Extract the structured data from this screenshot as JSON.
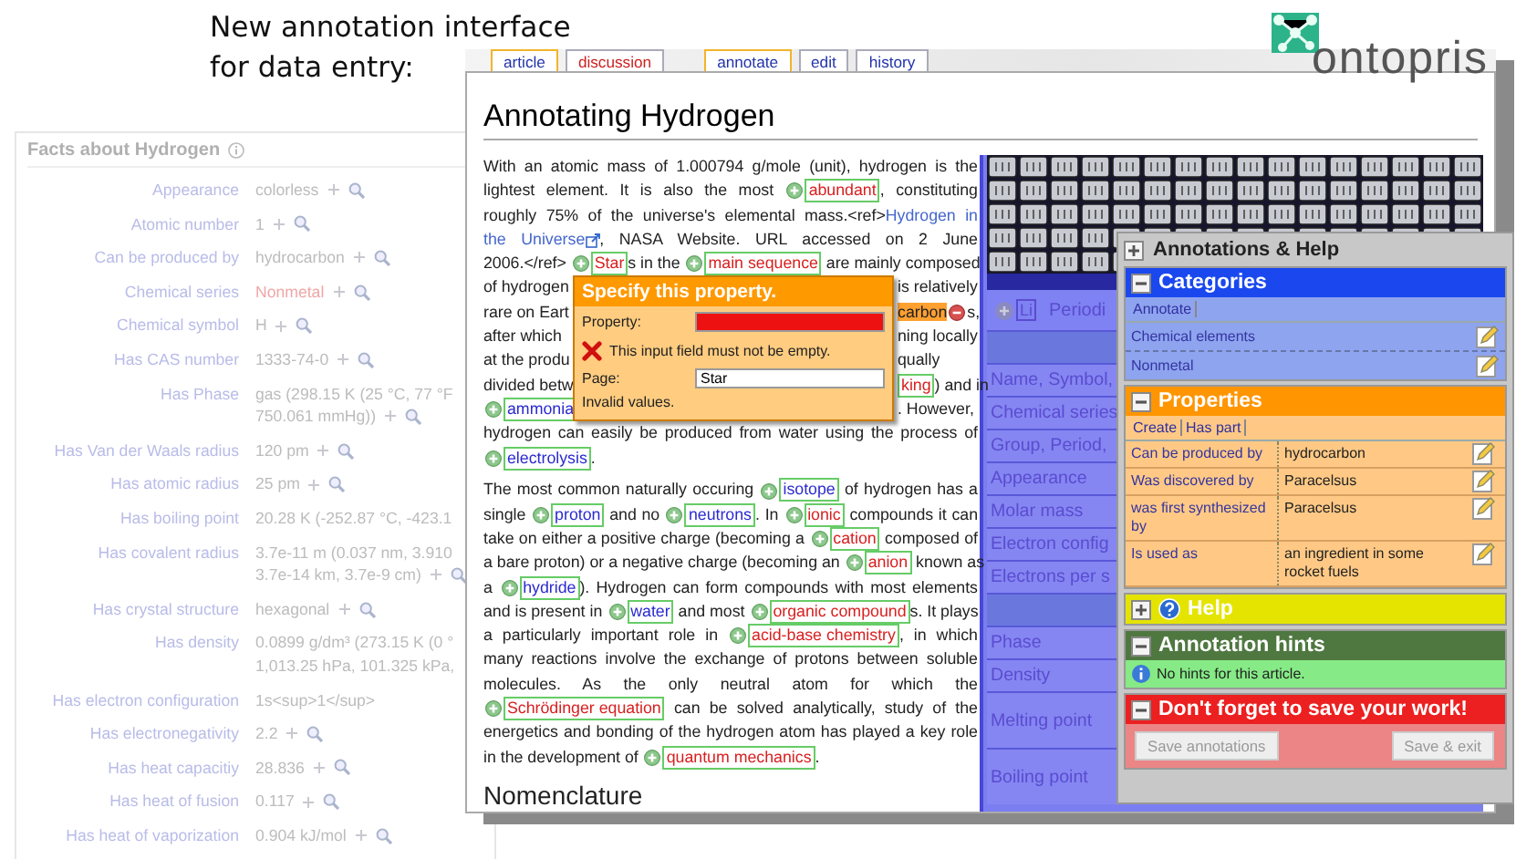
{
  "caption": [
    "New annotation interface",
    "for data entry:"
  ],
  "logo": {
    "text": "ontopris"
  },
  "facts_panel": {
    "title": "Facts about Hydrogen",
    "rows": [
      {
        "label": "Appearance",
        "lines": [
          "colorless"
        ],
        "tools": true,
        "exists": true
      },
      {
        "label": "Atomic number",
        "lines": [
          "1"
        ],
        "tools": true,
        "exists": true
      },
      {
        "label": "Can be produced by",
        "lines": [
          "hydrocarbon"
        ],
        "tools": true,
        "exists": true
      },
      {
        "label": "Chemical series",
        "lines": [
          "Nonmetal"
        ],
        "tools": true,
        "exists": false
      },
      {
        "label": "Chemical symbol",
        "lines": [
          "H"
        ],
        "tools": true,
        "exists": true
      },
      {
        "label": "Has CAS number",
        "lines": [
          "1333-74-0"
        ],
        "tools": true,
        "exists": true
      },
      {
        "label": "Has Phase",
        "lines": [
          "gas (298.15 K (25 °C, 77 °F",
          "750.061 mmHg))"
        ],
        "tools": true,
        "exists": true
      },
      {
        "label": "Has Van der Waals radius",
        "lines": [
          "120 pm"
        ],
        "tools": true,
        "exists": true
      },
      {
        "label": "Has atomic radius",
        "lines": [
          "25 pm"
        ],
        "tools": true,
        "exists": true
      },
      {
        "label": "Has boiling point",
        "lines": [
          "20.28 K (-252.87 °C, -423.1"
        ],
        "tools": false,
        "exists": true
      },
      {
        "label": "Has covalent radius",
        "lines": [
          "3.7e-11 m (0.037 nm, 3.910",
          "3.7e-14 km, 3.7e-9 cm)"
        ],
        "tools": true,
        "exists": true
      },
      {
        "label": "Has crystal structure",
        "lines": [
          "hexagonal"
        ],
        "tools": true,
        "exists": true
      },
      {
        "label": "Has density",
        "lines": [
          "0.0899 g/dm³ (273.15 K (0 °",
          "1,013.25 hPa, 101.325 kPa,"
        ],
        "tools": false,
        "exists": true
      },
      {
        "label": "Has electron configuration",
        "lines": [
          "1s<sup>1</sup>"
        ],
        "tools": false,
        "exists": true
      },
      {
        "label": "Has electronegativity",
        "lines": [
          "2.2"
        ],
        "tools": true,
        "exists": true
      },
      {
        "label": "Has heat capacitiy",
        "lines": [
          "28.836"
        ],
        "tools": true,
        "exists": true
      },
      {
        "label": "Has heat of fusion",
        "lines": [
          "0.117"
        ],
        "tools": true,
        "exists": true
      },
      {
        "label": "Has heat of vaporization",
        "lines": [
          "0.904 kJ/mol"
        ],
        "tools": true,
        "exists": true
      }
    ]
  },
  "window": {
    "page_tabs": [
      {
        "label": "article",
        "selected": true,
        "exists": true
      },
      {
        "label": "discussion",
        "selected": false,
        "exists": false
      }
    ],
    "action_tabs": [
      {
        "label": "annotate",
        "selected": true
      },
      {
        "label": "edit",
        "selected": false
      },
      {
        "label": "history",
        "selected": false
      }
    ],
    "title": "Annotating Hydrogen",
    "paragraphs": [
      {
        "lines": [
          {
            "segments": [
              {
                "kind": "text",
                "text": "With an atomic mass of 1.000794 g/mole (unit), hydrogen is the"
              }
            ]
          },
          {
            "segments": [
              {
                "kind": "text",
                "text": "lightest element. It is also the most "
              },
              {
                "kind": "annotation",
                "text": "abundant",
                "exists": false,
                "icon": true
              },
              {
                "kind": "text",
                "text": ", constituting"
              }
            ]
          },
          {
            "segments": [
              {
                "kind": "text",
                "text": "roughly 75% of the universe's elemental mass.<ref>"
              },
              {
                "kind": "external",
                "text": "Hydrogen in",
                "icon": false
              }
            ]
          },
          {
            "segments": [
              {
                "kind": "external",
                "text": "the Universe",
                "icon": true
              },
              {
                "kind": "text",
                "text": ", NASA Website. URL accessed on 2 June"
              }
            ]
          },
          {
            "segments": [
              {
                "kind": "text",
                "text": "2006.</ref> "
              },
              {
                "kind": "annotation",
                "text": "Star",
                "exists": false,
                "icon": true
              },
              {
                "kind": "text",
                "text": "s in the "
              },
              {
                "kind": "annotation",
                "text": "main sequence",
                "exists": false,
                "icon": true
              },
              {
                "kind": "text",
                "text": " are mainly composed"
              }
            ]
          },
          {
            "left": [
              {
                "kind": "text",
                "text": "of hydrogen"
              }
            ],
            "right": [
              {
                "kind": "text",
                "text": "is relatively"
              }
            ]
          },
          {
            "left": [
              {
                "kind": "text",
                "text": "rare on Eart"
              }
            ],
            "right": [
              {
                "kind": "editing",
                "text": "carbon"
              },
              {
                "kind": "text",
                "text": "s,"
              }
            ]
          },
          {
            "left": [
              {
                "kind": "text",
                "text": "after which"
              }
            ],
            "right": [
              {
                "kind": "text",
                "text": "ning locally"
              }
            ]
          },
          {
            "left": [
              {
                "kind": "text",
                "text": "at the produ"
              }
            ],
            "right": [
              {
                "kind": "text",
                "text": "qually"
              }
            ]
          },
          {
            "left": [
              {
                "kind": "text",
                "text": "divided betw"
              }
            ],
            "right": [
              {
                "kind": "annotation",
                "text": "king",
                "exists": false,
                "icon": false
              },
              {
                "kind": "text",
                "text": ") and in"
              }
            ]
          },
          {
            "left": [
              {
                "kind": "annotation",
                "text": "ammonia",
                "exists": true,
                "icon": true
              }
            ],
            "right": [
              {
                "kind": "text",
                "text": ". However,"
              }
            ]
          },
          {
            "segments": [
              {
                "kind": "text",
                "text": "hydrogen can easily be produced from water using the process of"
              }
            ]
          },
          {
            "segments": [
              {
                "kind": "annotation",
                "text": "electrolysis",
                "exists": true,
                "icon": true
              },
              {
                "kind": "text",
                "text": "."
              }
            ]
          }
        ]
      },
      {
        "lines": [
          {
            "segments": [
              {
                "kind": "text",
                "text": "The most common naturally occuring "
              },
              {
                "kind": "annotation",
                "text": "isotope",
                "exists": true,
                "icon": true
              },
              {
                "kind": "text",
                "text": " of hydrogen has a"
              }
            ]
          },
          {
            "segments": [
              {
                "kind": "text",
                "text": "single "
              },
              {
                "kind": "annotation",
                "text": "proton",
                "exists": true,
                "icon": true
              },
              {
                "kind": "text",
                "text": " and no "
              },
              {
                "kind": "annotation",
                "text": "neutrons",
                "exists": true,
                "icon": true
              },
              {
                "kind": "text",
                "text": ". In "
              },
              {
                "kind": "annotation",
                "text": "ionic",
                "exists": false,
                "icon": true
              },
              {
                "kind": "text",
                "text": " compounds it can"
              }
            ]
          },
          {
            "segments": [
              {
                "kind": "text",
                "text": "take on either a positive charge (becoming a "
              },
              {
                "kind": "annotation",
                "text": "cation",
                "exists": false,
                "icon": true
              },
              {
                "kind": "text",
                "text": " composed of"
              }
            ]
          },
          {
            "segments": [
              {
                "kind": "text",
                "text": "a bare proton) or a negative charge (becoming an "
              },
              {
                "kind": "annotation",
                "text": "anion",
                "exists": false,
                "icon": true
              },
              {
                "kind": "text",
                "text": " known as"
              }
            ]
          },
          {
            "segments": [
              {
                "kind": "text",
                "text": "a "
              },
              {
                "kind": "annotation",
                "text": "hydride",
                "exists": true,
                "icon": true
              },
              {
                "kind": "text",
                "text": "). Hydrogen can form compounds with most elements"
              }
            ]
          },
          {
            "segments": [
              {
                "kind": "text",
                "text": "and is present in "
              },
              {
                "kind": "annotation",
                "text": "water",
                "exists": true,
                "icon": true
              },
              {
                "kind": "text",
                "text": " and most "
              },
              {
                "kind": "annotation",
                "text": "organic compound",
                "exists": false,
                "icon": true
              },
              {
                "kind": "text",
                "text": "s. It plays"
              }
            ]
          },
          {
            "segments": [
              {
                "kind": "text",
                "text": "a particularly important role in "
              },
              {
                "kind": "annotation",
                "text": "acid-base chemistry",
                "exists": false,
                "icon": true
              },
              {
                "kind": "text",
                "text": ", in which"
              }
            ]
          },
          {
            "segments": [
              {
                "kind": "text",
                "text": "many reactions involve the exchange of protons between soluble"
              }
            ]
          },
          {
            "segments": [
              {
                "kind": "text",
                "text": "molecules. As the only neutral atom for which the"
              }
            ]
          },
          {
            "segments": [
              {
                "kind": "annotation",
                "text": "Schrödinger equation",
                "exists": false,
                "icon": true
              },
              {
                "kind": "text",
                "text": " can be solved analytically, study of the"
              }
            ]
          },
          {
            "segments": [
              {
                "kind": "text",
                "text": "energetics and bonding of the hydrogen atom has played a key role"
              }
            ]
          },
          {
            "segments": [
              {
                "kind": "text",
                "text": "in the development of "
              },
              {
                "kind": "annotation",
                "text": "quantum mechanics",
                "exists": false,
                "icon": true
              },
              {
                "kind": "text",
                "text": "."
              }
            ]
          }
        ]
      }
    ],
    "heading": "Nomenclature",
    "popup": {
      "title": "Specify this property.",
      "fields": [
        {
          "label": "Property:",
          "invalid": true
        },
        {
          "label": "Page:",
          "value": "Star",
          "invalid": false
        }
      ],
      "error": "This input field must not be empty.",
      "status": "Invalid values."
    },
    "infobox": {
      "title": "Periodi",
      "nav_label": "Li",
      "rows": [
        {
          "kind": "section"
        },
        {
          "kind": "row",
          "label": "Name, Symbol,"
        },
        {
          "kind": "row",
          "label": "Chemical series"
        },
        {
          "kind": "row",
          "label": "Group, Period,"
        },
        {
          "kind": "row",
          "label": "Appearance"
        },
        {
          "kind": "row",
          "label": "Molar mass"
        },
        {
          "kind": "row",
          "label": "Electron config"
        },
        {
          "kind": "row",
          "label": "Electrons per s"
        },
        {
          "kind": "section"
        },
        {
          "kind": "row",
          "label": "Phase"
        },
        {
          "kind": "row",
          "label": "Density"
        },
        {
          "kind": "tall",
          "label": "Melting point"
        },
        {
          "kind": "tall",
          "label": "Boiling point"
        }
      ]
    }
  },
  "annotation_panel": {
    "title": "Annotations & Help",
    "sections": [
      {
        "kind": "categories",
        "title": "Categories",
        "expanded": true,
        "toolbar": [
          "Annotate"
        ],
        "rows": [
          {
            "name": "Chemical elements"
          },
          {
            "name": "Nonmetal"
          }
        ]
      },
      {
        "kind": "properties",
        "title": "Properties",
        "expanded": true,
        "toolbar": [
          "Create",
          "Has part"
        ],
        "rows": [
          {
            "property": "Can be produced by",
            "value": "hydrocarbon"
          },
          {
            "property": "Was discovered by",
            "value": "Paracelsus"
          },
          {
            "property": "was first synthesized by",
            "value": "Paracelsus"
          },
          {
            "property": "Is used as",
            "value": "an ingredient in some rocket fuels"
          }
        ]
      },
      {
        "kind": "help",
        "title": "Help",
        "expanded": false
      },
      {
        "kind": "hints",
        "title": "Annotation hints",
        "expanded": true,
        "message": "No hints for this article."
      },
      {
        "kind": "save",
        "title": "Don't forget to save your work!",
        "expanded": true,
        "buttons": [
          {
            "label": "Save annotations",
            "disabled": true
          },
          {
            "label": "Save & exit",
            "disabled": true
          }
        ]
      }
    ]
  }
}
